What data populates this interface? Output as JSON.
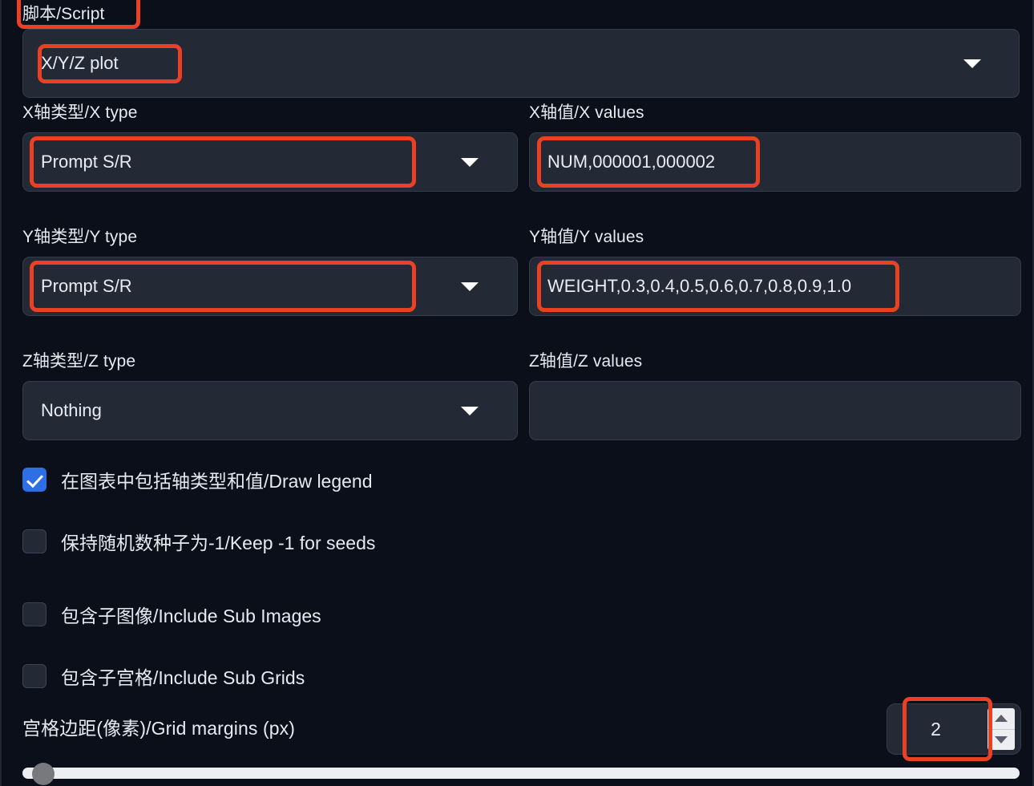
{
  "accent": {
    "annotation_red": "#ea4024",
    "checkbox_blue": "#2f6fe4",
    "field_bg": "#242936",
    "page_bg": "#0b0f19"
  },
  "script": {
    "label": "脚本/Script",
    "selected": "X/Y/Z plot",
    "caret_icon": "chevron-down-icon"
  },
  "x_axis": {
    "type_label": "X轴类型/X type",
    "type_value": "Prompt S/R",
    "values_label": "X轴值/X values",
    "values_value": "NUM,000001,000002"
  },
  "y_axis": {
    "type_label": "Y轴类型/Y type",
    "type_value": "Prompt S/R",
    "values_label": "Y轴值/Y values",
    "values_value": "WEIGHT,0.3,0.4,0.5,0.6,0.7,0.8,0.9,1.0"
  },
  "z_axis": {
    "type_label": "Z轴类型/Z type",
    "type_value": "Nothing",
    "values_label": "Z轴值/Z values",
    "values_value": ""
  },
  "checkboxes": [
    {
      "label": "在图表中包括轴类型和值/Draw legend",
      "checked": true
    },
    {
      "label": "保持随机数种子为-1/Keep -1 for seeds",
      "checked": false
    },
    {
      "label": "包含子图像/Include Sub Images",
      "checked": false
    },
    {
      "label": "包含子宫格/Include Sub Grids",
      "checked": false
    }
  ],
  "grid_margins": {
    "label": "宫格边距(像素)/Grid margins (px)",
    "value": "2",
    "increment_icon": "triangle-up-icon",
    "decrement_icon": "triangle-down-icon"
  }
}
